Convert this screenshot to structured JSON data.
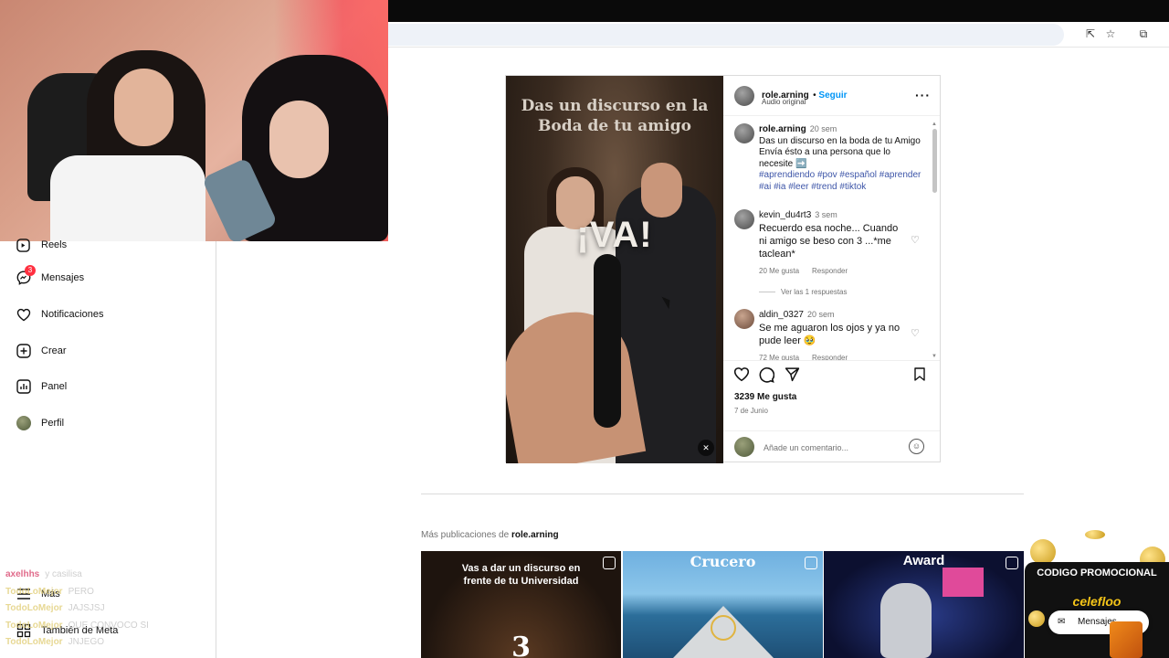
{
  "sidebar": {
    "items": [
      {
        "label": "Reels",
        "icon": "reels-icon"
      },
      {
        "label": "Mensajes",
        "icon": "messenger-icon",
        "badge": "3"
      },
      {
        "label": "Notificaciones",
        "icon": "heart-icon"
      },
      {
        "label": "Crear",
        "icon": "plus-icon"
      },
      {
        "label": "Panel",
        "icon": "chart-icon"
      },
      {
        "label": "Perfil",
        "icon": "avatar"
      },
      {
        "label": "Más",
        "icon": "menu-icon"
      },
      {
        "label": "También de Meta",
        "icon": "grid-icon"
      }
    ]
  },
  "chat_overlay": [
    {
      "user": "axelhhs",
      "msg": "y casilisa"
    },
    {
      "user": "TodoLoMejor",
      "msg": "PERO"
    },
    {
      "user": "TodoLoMejor",
      "msg": "JAJSJSJ"
    },
    {
      "user": "TodoLoMejor",
      "msg": "QUE CONVOCO SI"
    },
    {
      "user": "TodoLoMejor",
      "msg": "JNJEGO"
    }
  ],
  "post": {
    "reel_title": "Das un discurso en la Boda de tu amigo",
    "reel_overlay_text": "¡VA!",
    "author": "role.arning",
    "follow_label": "Seguir",
    "audio_label": "Audio original",
    "caption": {
      "user": "role.arning",
      "time": "20 sem",
      "text": "Das un discurso en la boda de tu Amigo Envía ésto a una persona que lo necesite ➡️",
      "tags": "#aprendiendo #pov #español #aprender #ai #ia #leer #trend #tiktok"
    },
    "comments": [
      {
        "user": "kevin_du4rt3",
        "time": "3 sem",
        "text": "Recuerdo esa noche... Cuando ni amigo se beso con 3 ...*me taclean*",
        "likes": "20 Me gusta",
        "reply": "Responder",
        "replies": "Ver las 1 respuestas"
      },
      {
        "user": "aldin_0327",
        "time": "20 sem",
        "text": "Se me aguaron los ojos y ya no pude leer 🥹",
        "likes": "72 Me gusta",
        "reply": "Responder"
      }
    ],
    "likes_count": "3239 Me gusta",
    "date": "7 de Junio",
    "add_comment_placeholder": "Añade un comentario..."
  },
  "more_posts": {
    "label_prefix": "Más publicaciones de",
    "label_user": "role.arning",
    "items": [
      {
        "caption": "Vas a dar un discurso en frente de tu Universidad",
        "number": "3"
      },
      {
        "caption": "Crucero"
      },
      {
        "caption": "Award"
      }
    ]
  },
  "promo": {
    "title": "CODIGO PROMOCIONAL",
    "brand": "celefloo",
    "messages_label": "Mensajes"
  }
}
